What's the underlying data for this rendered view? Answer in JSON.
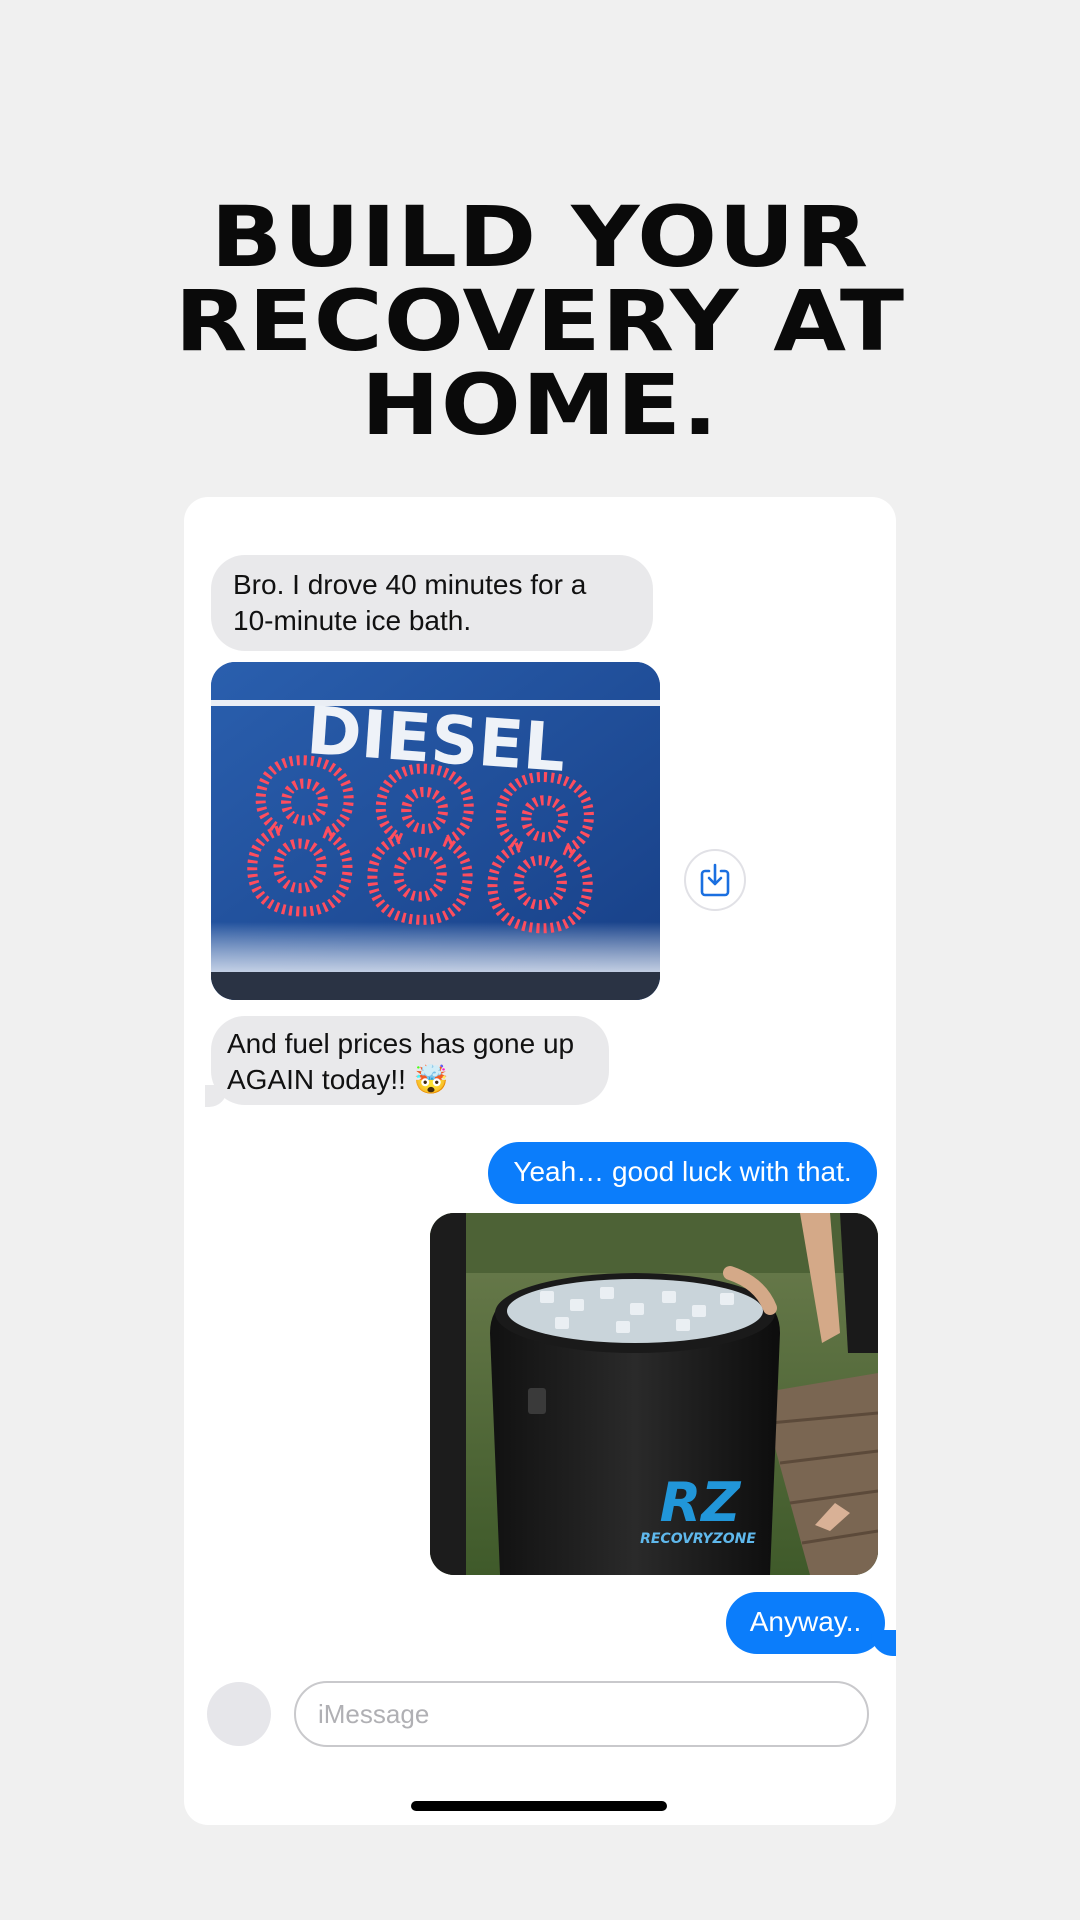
{
  "headline": {
    "line1": "BUILD YOUR",
    "line2": "RECOVERY AT",
    "line3": "HOME."
  },
  "conversation": {
    "messages": [
      {
        "from": "them",
        "text_line1": "Bro. I drove 40 minutes for a",
        "text_line2": "10-minute ice bath."
      },
      {
        "from": "them",
        "text_line1": "And fuel prices has gone up",
        "text_line2": "AGAIN today!! 🤯"
      },
      {
        "from": "me",
        "text": "Yeah… good luck with that."
      },
      {
        "from": "me",
        "text": "Anyway.."
      }
    ],
    "diesel_photo": {
      "sign_text": "DIESEL",
      "digits": "888"
    },
    "tub_photo": {
      "logo_mark": "RZ",
      "logo_text": "RECOVRYZONE"
    }
  },
  "composer": {
    "placeholder": "iMessage"
  },
  "icons": {
    "save": "download-to-device-icon"
  },
  "colors": {
    "background": "#f0f0f0",
    "incoming_bubble": "#e9e9eb",
    "outgoing_bubble": "#0b7dfb",
    "accent_icon": "#1a6fe0"
  }
}
